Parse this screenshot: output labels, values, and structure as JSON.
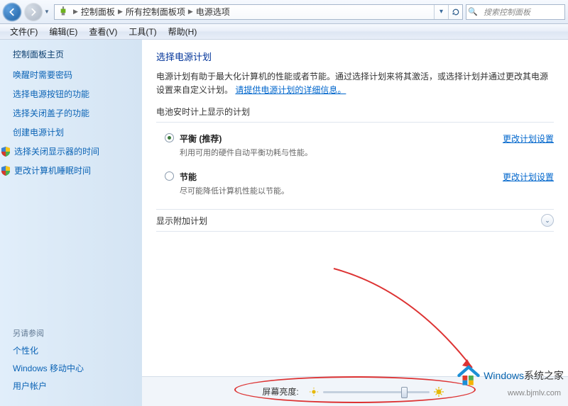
{
  "nav": {
    "crumbs": [
      "控制面板",
      "所有控制面板项",
      "电源选项"
    ]
  },
  "search": {
    "placeholder": "搜索控制面板"
  },
  "menu": {
    "file": "文件(F)",
    "edit": "编辑(E)",
    "view": "查看(V)",
    "tools": "工具(T)",
    "help": "帮助(H)"
  },
  "sidebar": {
    "home": "控制面板主页",
    "links": {
      "require_password": "唤醒时需要密码",
      "power_button": "选择电源按钮的功能",
      "close_lid": "选择关闭盖子的功能",
      "create_plan": "创建电源计划",
      "display_off": "选择关闭显示器的时间",
      "sleep_time": "更改计算机睡眠时间"
    },
    "see_also_hdr": "另请参阅",
    "see_also": {
      "personalization": "个性化",
      "mobility": "Windows 移动中心",
      "accounts": "用户帐户"
    }
  },
  "main": {
    "title": "选择电源计划",
    "desc_pre": "电源计划有助于最大化计算机的性能或者节能。通过选择计划来将其激活，或选择计划并通过更改其电源设置来自定义计划。",
    "desc_link": "请提供电源计划的详细信息。",
    "battery_hdr": "电池安时计上显示的计划",
    "plans": [
      {
        "name": "平衡",
        "rec": " (推荐)",
        "note": "利用可用的硬件自动平衡功耗与性能。",
        "selected": true
      },
      {
        "name": "节能",
        "rec": "",
        "note": "尽可能降低计算机性能以节能。",
        "selected": false
      }
    ],
    "change_link": "更改计划设置",
    "extra_hdr": "显示附加计划"
  },
  "footer": {
    "brightness_label": "屏幕亮度:"
  },
  "watermark": {
    "brand_a": "Windows",
    "brand_b": "系统之家",
    "url": "www.bjmlv.com"
  }
}
